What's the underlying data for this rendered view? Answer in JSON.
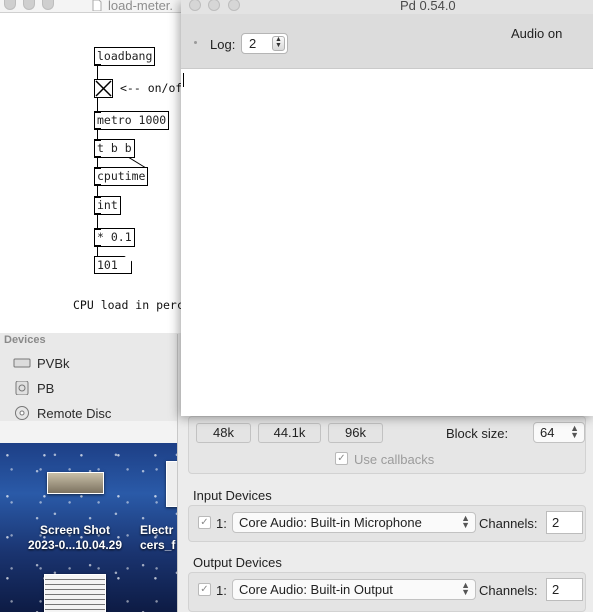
{
  "patch": {
    "title": "load-meter.",
    "objects": {
      "loadbang": "loadbang",
      "metro": "metro 1000",
      "trigger": "t b b",
      "cputime": "cputime",
      "int": "int",
      "mult": "* 0.1",
      "number": "101"
    },
    "toggle_comment": "<-- on/of",
    "bottom_comment": "CPU load in perc"
  },
  "finder": {
    "section": "Devices",
    "items": [
      {
        "label": "PVBk",
        "icon": "drive-icon"
      },
      {
        "label": "PB",
        "icon": "disk-icon"
      },
      {
        "label": "Remote Disc",
        "icon": "disc-icon"
      }
    ]
  },
  "desktop": {
    "icons": [
      {
        "label1": "Screen Shot",
        "label2": "2023-0...10.04.29"
      },
      {
        "label1": "Electr",
        "label2": "cers_f"
      }
    ]
  },
  "pd": {
    "title": "Pd 0.54.0",
    "log_label": "Log:",
    "log_value": "2",
    "audio_status": "Audio on"
  },
  "audio_settings": {
    "rates": [
      "48k",
      "44.1k",
      "96k"
    ],
    "block_size_label": "Block size:",
    "block_size_value": "64",
    "use_callbacks": "Use callbacks",
    "input_section": "Input Devices",
    "input_index": "1:",
    "input_device": "Core Audio: Built-in Microphone",
    "input_channels_label": "Channels:",
    "input_channels": "2",
    "output_section": "Output Devices",
    "output_index": "1:",
    "output_device": "Core Audio: Built-in Output",
    "output_channels_label": "Channels:",
    "output_channels": "2"
  }
}
